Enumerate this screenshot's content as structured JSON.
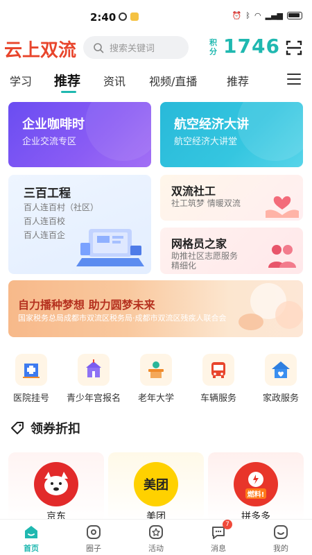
{
  "status_bar": {
    "time": "2:40"
  },
  "header": {
    "brand": "云上双流",
    "search_placeholder": "搜索关键词",
    "points_label": "积分",
    "points_value": "1746"
  },
  "tabs": [
    {
      "label": "学习",
      "active": false
    },
    {
      "label": "推荐",
      "active": true
    },
    {
      "label": "资讯",
      "active": false
    },
    {
      "label": "视频/直播",
      "active": false
    },
    {
      "label": "推荐",
      "active": false
    }
  ],
  "feature_cards": {
    "enterprise": {
      "title": "企业咖啡时",
      "subtitle": "企业交流专区"
    },
    "aviation": {
      "title": "航空经济大讲",
      "subtitle": "航空经济大讲堂"
    },
    "three_hundred": {
      "title": "三百工程",
      "lines": [
        "百人连百村（社区）",
        "百人连百校",
        "百人连百企"
      ]
    },
    "social_work": {
      "title": "双流社工",
      "subtitle": "社工筑梦 情暖双流"
    },
    "grid_member": {
      "title": "网格员之家",
      "subtitle": "助推社区志愿服务",
      "subtitle2": "精细化"
    }
  },
  "banner": {
    "title": "自力播种梦想  助力圆梦未来",
    "subtitle": "国家税务总局成都市双流区税务局·成都市双流区残疾人联合会"
  },
  "services": [
    {
      "label": "医院挂号",
      "icon": "hospital-icon"
    },
    {
      "label": "青少年宫报名",
      "icon": "youth-palace-icon"
    },
    {
      "label": "老年大学",
      "icon": "elder-university-icon"
    },
    {
      "label": "车辆服务",
      "icon": "bus-icon"
    },
    {
      "label": "家政服务",
      "icon": "housekeeping-icon"
    }
  ],
  "coupon_section": {
    "title": "领券折扣"
  },
  "coupons": [
    {
      "name": "京东",
      "logo_text": "",
      "color": "#e22a2a"
    },
    {
      "name": "美团",
      "logo_text": "美团",
      "color": "#ffd100"
    },
    {
      "name": "拼多多",
      "logo_text": "燃料!",
      "color": "#e8352a"
    }
  ],
  "bottom_nav": [
    {
      "label": "首页",
      "icon": "home-icon",
      "active": true
    },
    {
      "label": "圈子",
      "icon": "circle-icon",
      "active": false
    },
    {
      "label": "活动",
      "icon": "activity-icon",
      "active": false
    },
    {
      "label": "消息",
      "icon": "message-icon",
      "active": false,
      "badge": "7"
    },
    {
      "label": "我的",
      "icon": "profile-icon",
      "active": false
    }
  ],
  "colors": {
    "accent": "#1fb8b0",
    "brand": "#e8452c"
  }
}
